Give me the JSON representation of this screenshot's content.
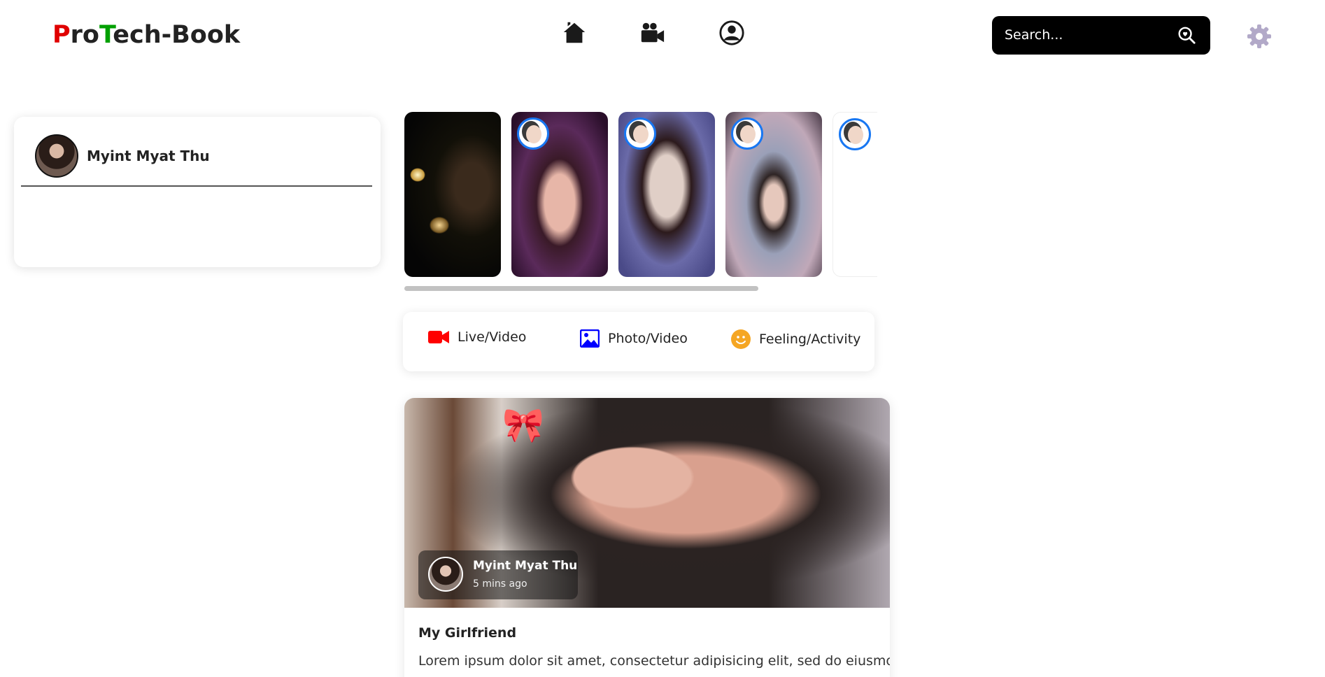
{
  "header": {
    "logo": {
      "p": "P",
      "ro": "ro",
      "t": "T",
      "rest": "ech-Book"
    },
    "nav": [
      {
        "name": "home-icon"
      },
      {
        "name": "video-icon"
      },
      {
        "name": "profile-icon"
      }
    ],
    "search": {
      "placeholder": "Search...",
      "icon": "search-icon"
    },
    "settings": {
      "icon": "gear-icon"
    }
  },
  "sidebar": {
    "user_name": "Myint Myat Thu"
  },
  "stories": {
    "items": [
      {
        "id": "story-1"
      },
      {
        "id": "story-2"
      },
      {
        "id": "story-3"
      },
      {
        "id": "story-4"
      },
      {
        "id": "story-5"
      }
    ]
  },
  "create": {
    "live_label": "Live/Video",
    "photo_label": "Photo/Video",
    "feeling_label": "Feeling/Activity",
    "colors": {
      "live": "#ff0000",
      "photo": "#0000ff",
      "feeling": "#f5a623"
    }
  },
  "post": {
    "author_name": "Myint Myat Thu",
    "time": "5 mins ago",
    "title": "My Girlfriend",
    "body": "Lorem ipsum dolor sit amet, consectetur adipisicing elit, sed do eiusmod"
  }
}
